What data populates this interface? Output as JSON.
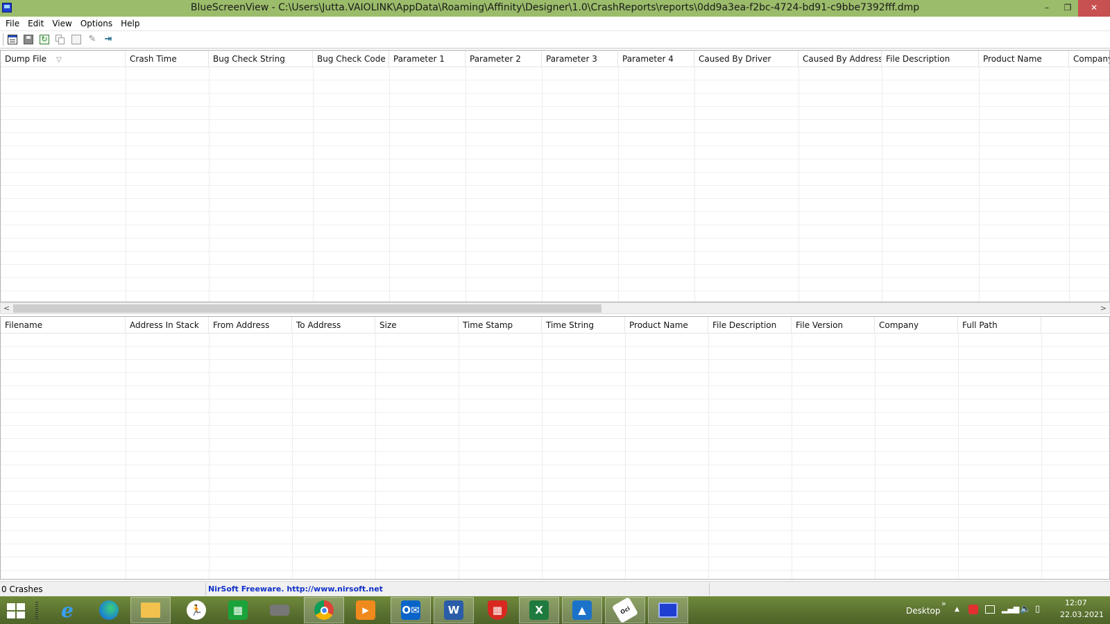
{
  "window": {
    "title": "BlueScreenView  -  C:\\Users\\Jutta.VAIOLINK\\AppData\\Roaming\\Affinity\\Designer\\1.0\\CrashReports\\reports\\0dd9a3ea-f2bc-4724-bd91-c9bbe7392fff.dmp",
    "minimize": "–",
    "restore": "❐",
    "close": "✕"
  },
  "menu": [
    "File",
    "Edit",
    "View",
    "Options",
    "Help"
  ],
  "toolbar": {
    "buttons": [
      "properties-icon",
      "save-icon",
      "refresh-icon",
      "copy-icon",
      "html-report-icon",
      "advanced-options-icon",
      "exit-icon"
    ]
  },
  "crash_list": {
    "columns": [
      "Dump File",
      "Crash Time",
      "Bug Check String",
      "Bug Check Code",
      "Parameter 1",
      "Parameter 2",
      "Parameter 3",
      "Parameter 4",
      "Caused By Driver",
      "Caused By Address",
      "File Description",
      "Product Name",
      "Company"
    ],
    "rows": []
  },
  "driver_list": {
    "columns": [
      "Filename",
      "Address In Stack",
      "From Address",
      "To Address",
      "Size",
      "Time Stamp",
      "Time String",
      "Product Name",
      "File Description",
      "File Version",
      "Company",
      "Full Path"
    ],
    "rows": []
  },
  "scrollbar": {
    "left_arrow": "<",
    "right_arrow": ">"
  },
  "status": {
    "count": "0 Crashes",
    "freeware": "NirSoft Freeware.  http://www.nirsoft.net"
  },
  "taskbar": {
    "apps": [
      "start-icon",
      "internet-explorer-icon",
      "edge-icon",
      "file-explorer-icon",
      "runner-app-icon",
      "store-icon",
      "scanner-icon",
      "chrome-icon",
      "media-player-icon",
      "outlook-icon",
      "word-icon",
      "security-shield-icon",
      "excel-icon",
      "affinity-designer-icon",
      "oci-disabler-icon",
      "bluescreenview-icon"
    ],
    "desktop_label": "Desktop",
    "chevron": "»",
    "time": "12:07",
    "date": "22.03.2021"
  }
}
